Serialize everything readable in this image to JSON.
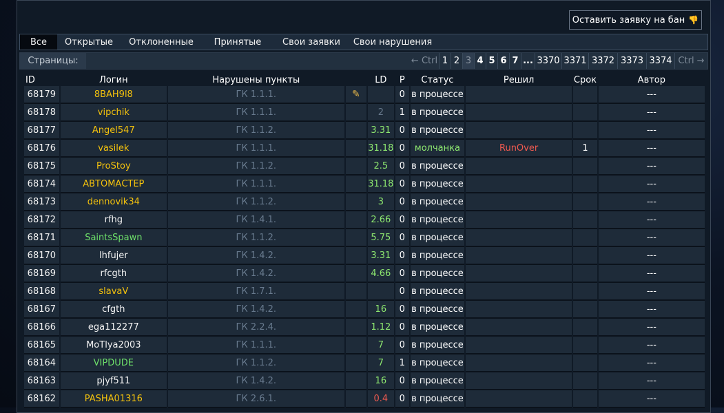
{
  "ban_button": {
    "label": "Оставить заявку на бан",
    "icon": "thumbs-down-icon"
  },
  "tabs": [
    "Все",
    "Открытые",
    "Отклоненные",
    "Принятые",
    "Свои заявки",
    "Свои нарушения"
  ],
  "active_tab": "Все",
  "pages": {
    "label": "Страницы:",
    "prev": "← Ctrl",
    "items": [
      "1",
      "2",
      "3",
      "4",
      "5",
      "6",
      "7",
      "...",
      "3370",
      "3371",
      "3372",
      "3373",
      "3374"
    ],
    "current": "3",
    "next": "Ctrl →"
  },
  "columns": {
    "id": "ID",
    "login": "Логин",
    "rules": "Нарушены пункты",
    "ld": "LD",
    "p": "P",
    "status": "Статус",
    "decided": "Решил",
    "term": "Срок",
    "author": "Автор"
  },
  "colors": {
    "name_yellow": "#f4c20d",
    "name_white": "#f2f2f2",
    "name_green": "#6ee06a",
    "ld_green": "#8ee870",
    "ld_red": "#f05a50",
    "decided_red": "#f05a50"
  },
  "rows": [
    {
      "id": "68179",
      "login": "8BAH9l8",
      "login_color": "yellow",
      "rules": "ГК 1.1.1.",
      "edit_icon": "pencil-icon",
      "ld": "",
      "ld_color": "green",
      "p": "0",
      "status": "в процессе",
      "status_color": "white",
      "decided": "",
      "term": "",
      "author": "---"
    },
    {
      "id": "68178",
      "login": "vipchik",
      "login_color": "yellow",
      "rules": "ГК 1.1.1.",
      "ld": "2",
      "ld_color": "gray",
      "p": "1",
      "status": "в процессе",
      "status_color": "white",
      "decided": "",
      "term": "",
      "author": "---"
    },
    {
      "id": "68177",
      "login": "Angel547",
      "login_color": "yellow",
      "rules": "ГК 1.1.2.",
      "ld": "3.31",
      "ld_color": "green",
      "p": "0",
      "status": "в процессе",
      "status_color": "white",
      "decided": "",
      "term": "",
      "author": "---"
    },
    {
      "id": "68176",
      "login": "vasilek",
      "login_color": "yellow",
      "rules": "ГК 1.1.1.",
      "ld": "31.18",
      "ld_color": "green",
      "p": "0",
      "status": "молчанка",
      "status_color": "green",
      "decided": "RunOver",
      "term": "1",
      "author": "---"
    },
    {
      "id": "68175",
      "login": "ProStoy",
      "login_color": "yellow",
      "rules": "ГК 1.1.2.",
      "ld": "2.5",
      "ld_color": "green",
      "p": "0",
      "status": "в процессе",
      "status_color": "white",
      "decided": "",
      "term": "",
      "author": "---"
    },
    {
      "id": "68174",
      "login": "АВТОМАСТЕР",
      "login_color": "yellow",
      "rules": "ГК 1.1.1.",
      "ld": "31.18",
      "ld_color": "green",
      "p": "0",
      "status": "в процессе",
      "status_color": "white",
      "decided": "",
      "term": "",
      "author": "---"
    },
    {
      "id": "68173",
      "login": "dennovik34",
      "login_color": "yellow",
      "rules": "ГК 1.1.2.",
      "ld": "3",
      "ld_color": "green",
      "p": "0",
      "status": "в процессе",
      "status_color": "white",
      "decided": "",
      "term": "",
      "author": "---"
    },
    {
      "id": "68172",
      "login": "rfhg",
      "login_color": "white",
      "rules": "ГК 1.4.1.",
      "ld": "2.66",
      "ld_color": "green",
      "p": "0",
      "status": "в процессе",
      "status_color": "white",
      "decided": "",
      "term": "",
      "author": "---"
    },
    {
      "id": "68171",
      "login": "SaintsSpawn",
      "login_color": "green",
      "rules": "ГК 1.1.2.",
      "ld": "5.75",
      "ld_color": "green",
      "p": "0",
      "status": "в процессе",
      "status_color": "white",
      "decided": "",
      "term": "",
      "author": "---"
    },
    {
      "id": "68170",
      "login": "lhfujer",
      "login_color": "white",
      "rules": "ГК 1.4.2.",
      "ld": "3.31",
      "ld_color": "green",
      "p": "0",
      "status": "в процессе",
      "status_color": "white",
      "decided": "",
      "term": "",
      "author": "---"
    },
    {
      "id": "68169",
      "login": "rfcgth",
      "login_color": "white",
      "rules": "ГК 1.4.2.",
      "ld": "4.66",
      "ld_color": "green",
      "p": "0",
      "status": "в процессе",
      "status_color": "white",
      "decided": "",
      "term": "",
      "author": "---"
    },
    {
      "id": "68168",
      "login": "slavaV",
      "login_color": "yellow",
      "rules": "ГК 1.7.1.",
      "ld": "",
      "ld_color": "green",
      "p": "0",
      "status": "в процессе",
      "status_color": "white",
      "decided": "",
      "term": "",
      "author": "---"
    },
    {
      "id": "68167",
      "login": "cfgth",
      "login_color": "white",
      "rules": "ГК 1.4.2.",
      "ld": "16",
      "ld_color": "green",
      "p": "0",
      "status": "в процессе",
      "status_color": "white",
      "decided": "",
      "term": "",
      "author": "---"
    },
    {
      "id": "68166",
      "login": "ega112277",
      "login_color": "white",
      "rules": "ГК 2.2.4.",
      "ld": "1.12",
      "ld_color": "green",
      "p": "0",
      "status": "в процессе",
      "status_color": "white",
      "decided": "",
      "term": "",
      "author": "---"
    },
    {
      "id": "68165",
      "login": "MoTlya2003",
      "login_color": "white",
      "rules": "ГК 1.1.1.",
      "ld": "7",
      "ld_color": "green",
      "p": "0",
      "status": "в процессе",
      "status_color": "white",
      "decided": "",
      "term": "",
      "author": "---"
    },
    {
      "id": "68164",
      "login": "VIPDUDE",
      "login_color": "green",
      "rules": "ГК 1.1.2.",
      "ld": "7",
      "ld_color": "green",
      "p": "1",
      "status": "в процессе",
      "status_color": "white",
      "decided": "",
      "term": "",
      "author": "---"
    },
    {
      "id": "68163",
      "login": "pjyf511",
      "login_color": "white",
      "rules": "ГК 1.4.2.",
      "ld": "16",
      "ld_color": "green",
      "p": "0",
      "status": "в процессе",
      "status_color": "white",
      "decided": "",
      "term": "",
      "author": "---"
    },
    {
      "id": "68162",
      "login": "PASHA01316",
      "login_color": "yellow",
      "rules": "ГК 2.6.1.",
      "ld": "0.4",
      "ld_color": "red",
      "p": "0",
      "status": "в процессе",
      "status_color": "white",
      "decided": "",
      "term": "",
      "author": "---"
    }
  ]
}
